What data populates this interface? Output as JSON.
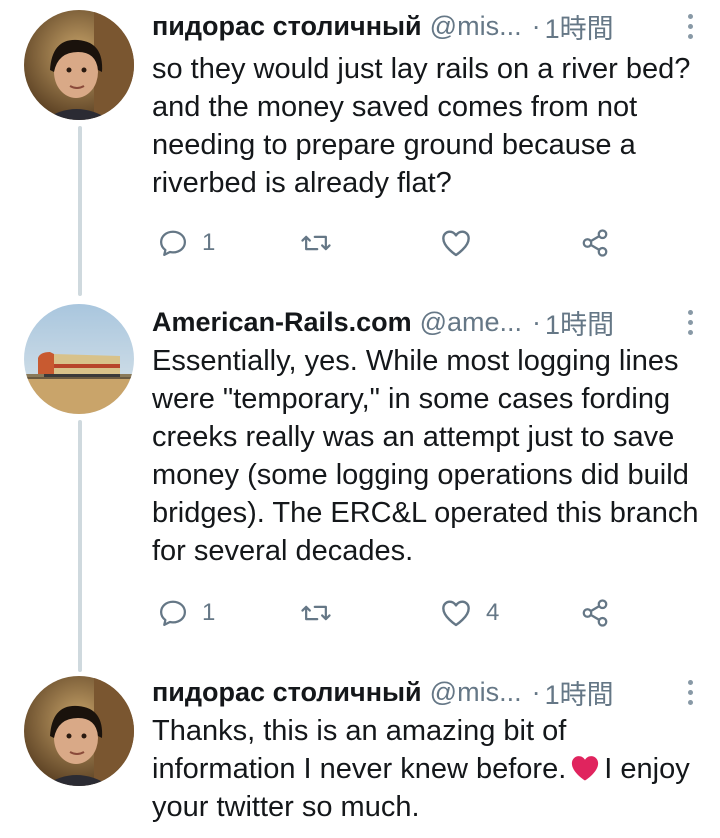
{
  "tweets": [
    {
      "name": "пидорас столичный",
      "handle": "@mis...",
      "separator": "·",
      "time": "1時間",
      "text": "so they would just lay rails on a river bed? and the money saved comes from not needing to prepare ground because a riverbed is already flat?",
      "replies": "1",
      "retweets": "",
      "likes": ""
    },
    {
      "name": "American-Rails.com",
      "handle": "@ame...",
      "separator": "·",
      "time": "1時間",
      "text": "Essentially, yes.  While most logging lines were \"temporary,\" in some cases fording creeks really was an attempt just to save money (some logging operations did build bridges). The ERC&L operated this branch for several decades.",
      "replies": "1",
      "retweets": "",
      "likes": "4"
    },
    {
      "name": "пидорас столичный",
      "handle": "@mis...",
      "separator": "·",
      "time": "1時間",
      "text_before": "Thanks, this is an amazing bit of information I never knew before.",
      "text_after": "I enjoy your twitter so much."
    }
  ],
  "colors": {
    "text": "#14171a",
    "secondary": "#657786",
    "icon": "#657786",
    "thread_line": "#cfd9de",
    "heart_emoji": "#e0245e"
  }
}
